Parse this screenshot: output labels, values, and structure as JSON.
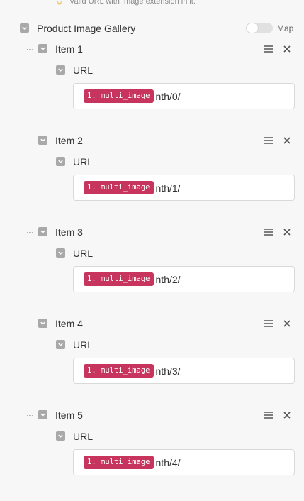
{
  "hint": {
    "text": "Valid URL with Image extension in it."
  },
  "gallery": {
    "label": "Product Image Gallery",
    "map_toggle": {
      "label": "Map",
      "on": false
    },
    "items": [
      {
        "label": "Item 1",
        "url_label": "URL",
        "token": "1. multi_image",
        "path": "nth/0/"
      },
      {
        "label": "Item 2",
        "url_label": "URL",
        "token": "1. multi_image",
        "path": "nth/1/"
      },
      {
        "label": "Item 3",
        "url_label": "URL",
        "token": "1. multi_image",
        "path": "nth/2/"
      },
      {
        "label": "Item 4",
        "url_label": "URL",
        "token": "1. multi_image",
        "path": "nth/3/"
      },
      {
        "label": "Item 5",
        "url_label": "URL",
        "token": "1. multi_image",
        "path": "nth/4/"
      }
    ]
  },
  "colors": {
    "token": "#c7345d",
    "checkbox": "#a9a9a9",
    "hint_icon": "#f0c060"
  },
  "icons": {
    "hint": "lightbulb-icon",
    "checkbox": "check-icon",
    "reorder": "menu-icon",
    "remove": "close-icon"
  }
}
